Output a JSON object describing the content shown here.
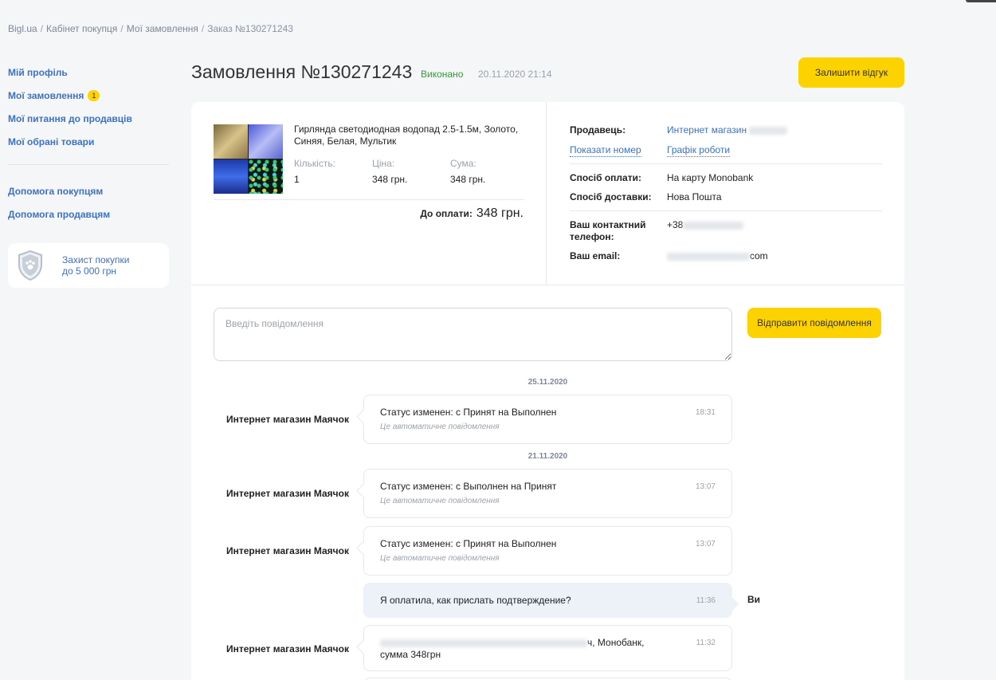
{
  "breadcrumb": [
    "Bigl.ua",
    "Кабінет покупця",
    "Мої замовлення",
    "Заказ №130271243"
  ],
  "sidebar": {
    "items": [
      {
        "label": "Мій профіль"
      },
      {
        "label": "Мої замовлення",
        "badge": "1"
      },
      {
        "label": "Мої питання до продавців"
      },
      {
        "label": "Мої обрані товари"
      }
    ],
    "help": [
      {
        "label": "Допомога покупцям"
      },
      {
        "label": "Допомога продавцям"
      }
    ],
    "protection": {
      "line1": "Захист покупки",
      "line2": "до 5 000 грн"
    }
  },
  "order": {
    "title": "Замовлення №130271243",
    "status": "Виконано",
    "date": "20.11.2020 21:14",
    "review_button": "Залишити відгук",
    "product": {
      "name": "Гирлянда светодиодная водопад 2.5-1.5м, Золото, Синяя, Белая, Мультик",
      "qty_label": "Кількість:",
      "qty": "1",
      "price_label": "Ціна:",
      "price": "348 грн.",
      "sum_label": "Сума:",
      "sum": "348 грн."
    },
    "to_pay_label": "До оплати:",
    "to_pay": "348 грн.",
    "seller_label": "Продавець:",
    "seller": "Интернет магазин",
    "show_number": "Показати номер",
    "schedule": "Графік роботи",
    "payment_label": "Спосіб оплати:",
    "payment": "На карту Monobank",
    "delivery_label": "Спосіб доставки:",
    "delivery": "Нова Пошта",
    "phone_label": "Ваш контактний телефон:",
    "phone": "+38",
    "email_label": "Ваш email:",
    "email_suffix": "com"
  },
  "chat": {
    "placeholder": "Введіть повідомлення",
    "send_button": "Відправити повідомлення",
    "auto_note": "Це автоматичне повідомлення",
    "me_label": "Ви",
    "days": [
      "25.11.2020",
      "21.11.2020"
    ],
    "messages": [
      {
        "sender": "Интернет магазин Маячок",
        "text": "Статус изменен: с Принят на Выполнен",
        "time": "18:31"
      },
      {
        "sender": "Интернет магазин Маячок",
        "text": "Статус изменен: с Выполнен на Принят",
        "time": "13:07"
      },
      {
        "sender": "Интернет магазин Маячок",
        "text": "Статус изменен: с Принят на Выполнен",
        "time": "13:07"
      },
      {
        "sender": "Ви",
        "text": "Я оплатила, как прислать подтверждение?",
        "time": "11:36"
      },
      {
        "sender": "Интернет магазин Маячок",
        "text_tail": "ч, Монобанк, сумма 348грн",
        "time": "11:32"
      }
    ]
  },
  "colors": {
    "accent": "#fcd200",
    "link": "#3d71c2",
    "status_done": "#2e9e2e",
    "background": "#f5f6f8"
  }
}
